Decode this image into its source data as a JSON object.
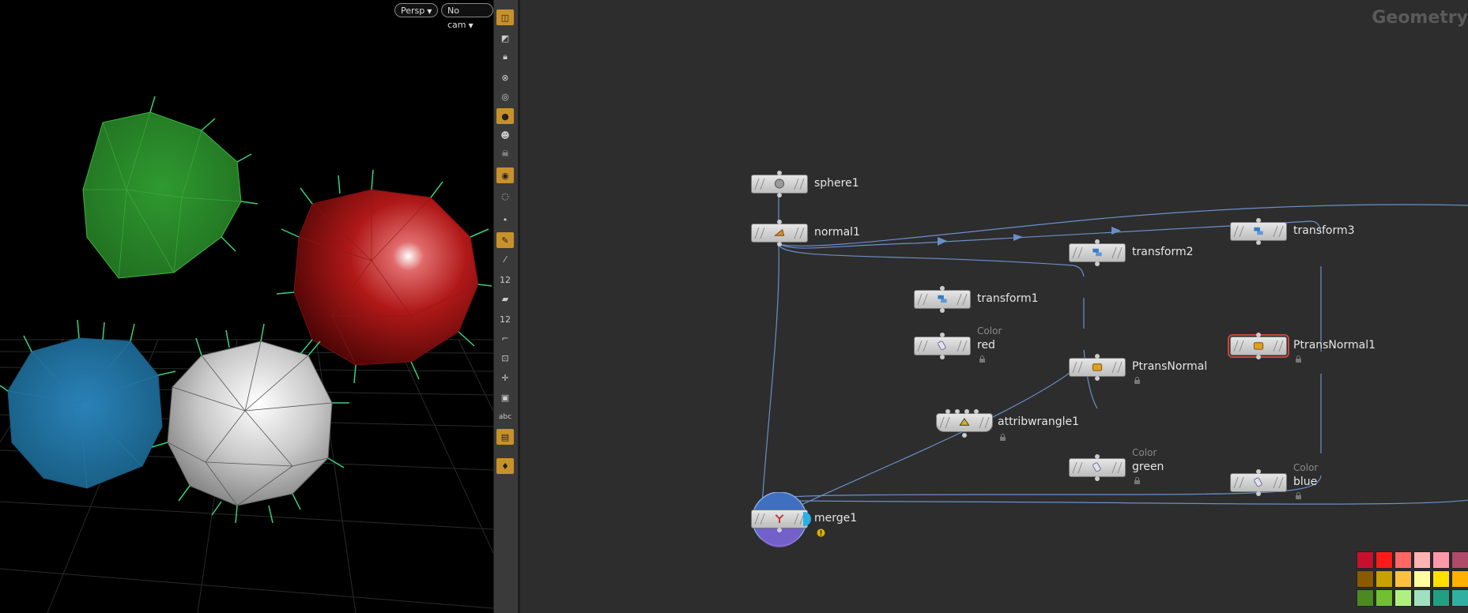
{
  "viewport": {
    "persp_label": "Persp",
    "cam_label": "No cam",
    "sphere_colors": {
      "green": "#2e8b2e",
      "red": "#b01818",
      "blue": "#1f6e9e",
      "white": "#cfcfcf"
    }
  },
  "toolbar": {
    "icons": [
      "display-options-icon",
      "shading-icon",
      "lock-icon",
      "ghost-icon",
      "sphere-display-icon",
      "light-icon",
      "skull-icon",
      "skull-alt-icon",
      "camera-icon",
      "visibility-icon",
      "point-icon",
      "paint-brush-icon",
      "eyedropper-icon",
      "point-number-icon",
      "primitive-icon",
      "primitive-number-icon",
      "angle-icon",
      "snap-icon",
      "handle-icon",
      "frame-icon",
      "text-label-icon",
      "image-icon",
      "pin-icon"
    ],
    "text_icon_label": "abc",
    "number_label_1": "12",
    "number_label_2": "12"
  },
  "network": {
    "title": "Geometry",
    "nodes": {
      "sphere1": {
        "name": "sphere1"
      },
      "normal1": {
        "name": "normal1"
      },
      "transform1": {
        "name": "transform1"
      },
      "transform2": {
        "name": "transform2"
      },
      "transform3": {
        "name": "transform3"
      },
      "red": {
        "name": "red",
        "comment": "Color"
      },
      "green": {
        "name": "green",
        "comment": "Color"
      },
      "blue": {
        "name": "blue",
        "comment": "Color"
      },
      "ptrans": {
        "name": "PtransNormal"
      },
      "ptrans1": {
        "name": "PtransNormal1"
      },
      "wrangle": {
        "name": "attribwrangle1"
      },
      "merge": {
        "name": "merge1"
      }
    },
    "wire_color": "#6a8fc8",
    "warning_color": "#e0b000"
  },
  "palette": {
    "colors": [
      "#c8102e",
      "#ff1a1a",
      "#ff6666",
      "#ffb3b3",
      "#ff99aa",
      "#b04a6a",
      "#8a5a00",
      "#c8a000",
      "#ffc040",
      "#ffffa0",
      "#ffe000",
      "#ffb000",
      "#4a8a20",
      "#70c030",
      "#b0f080",
      "#a0e0c0",
      "#20a080",
      "#30b0a0"
    ]
  }
}
